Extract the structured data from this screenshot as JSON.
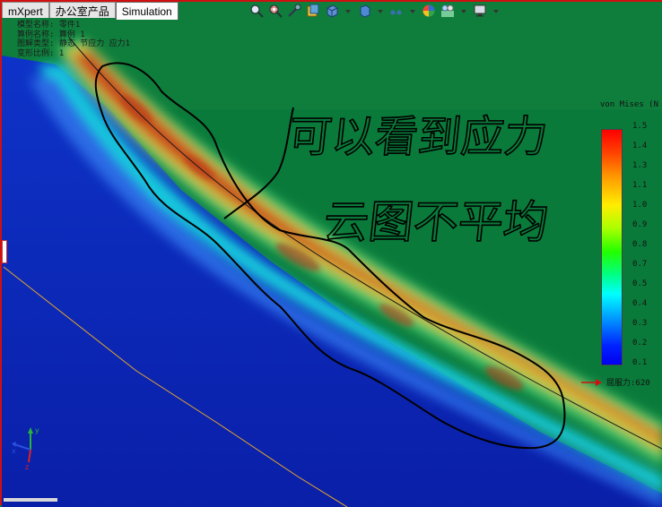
{
  "tabs": [
    {
      "label": "mXpert"
    },
    {
      "label": "办公室产品"
    },
    {
      "label": "Simulation"
    }
  ],
  "info": {
    "model_name": "模型名称: 零件1",
    "study_name": "算例名称: 算例 1",
    "plot_type": "图解类型: 静态 节应力 应力1",
    "deform_scale": "变形比例: 1"
  },
  "toolbar": [
    {
      "icon": "zoom-to-fit-icon"
    },
    {
      "icon": "zoom-area-icon"
    },
    {
      "icon": "zoom-in-out-icon"
    },
    {
      "icon": "3d-view-icon"
    },
    {
      "icon": "section-view-icon"
    },
    {
      "icon": "dropdown-arrow-icon"
    },
    {
      "icon": "view-orientation-icon"
    },
    {
      "icon": "dropdown-arrow-icon"
    },
    {
      "icon": "display-style-icon"
    },
    {
      "icon": "dropdown-arrow-icon"
    },
    {
      "icon": "appearance-icon"
    },
    {
      "icon": "scene-icon"
    },
    {
      "icon": "dropdown-arrow-icon"
    },
    {
      "icon": "monitor-icon"
    },
    {
      "icon": "dropdown-arrow-icon"
    }
  ],
  "legend": {
    "title": "von Mises (N",
    "ticks": [
      "1.5",
      "1.4",
      "1.3",
      "1.1",
      "1.0",
      "0.9",
      "0.8",
      "0.7",
      "0.5",
      "0.4",
      "0.3",
      "0.2",
      "0.1"
    ],
    "yield_label": "屈服力:620"
  },
  "annotation": {
    "line1": "可以看到应力",
    "line2": "云图不平均"
  },
  "triad": {
    "x": "x",
    "y": "y",
    "z": "z"
  },
  "colors": {
    "high_stress": "#c83a1c",
    "mid_stress": "#e8d23a",
    "low_stress": "#0f2fc8",
    "background_green": "#0a7a3a",
    "border": "#d01010"
  }
}
